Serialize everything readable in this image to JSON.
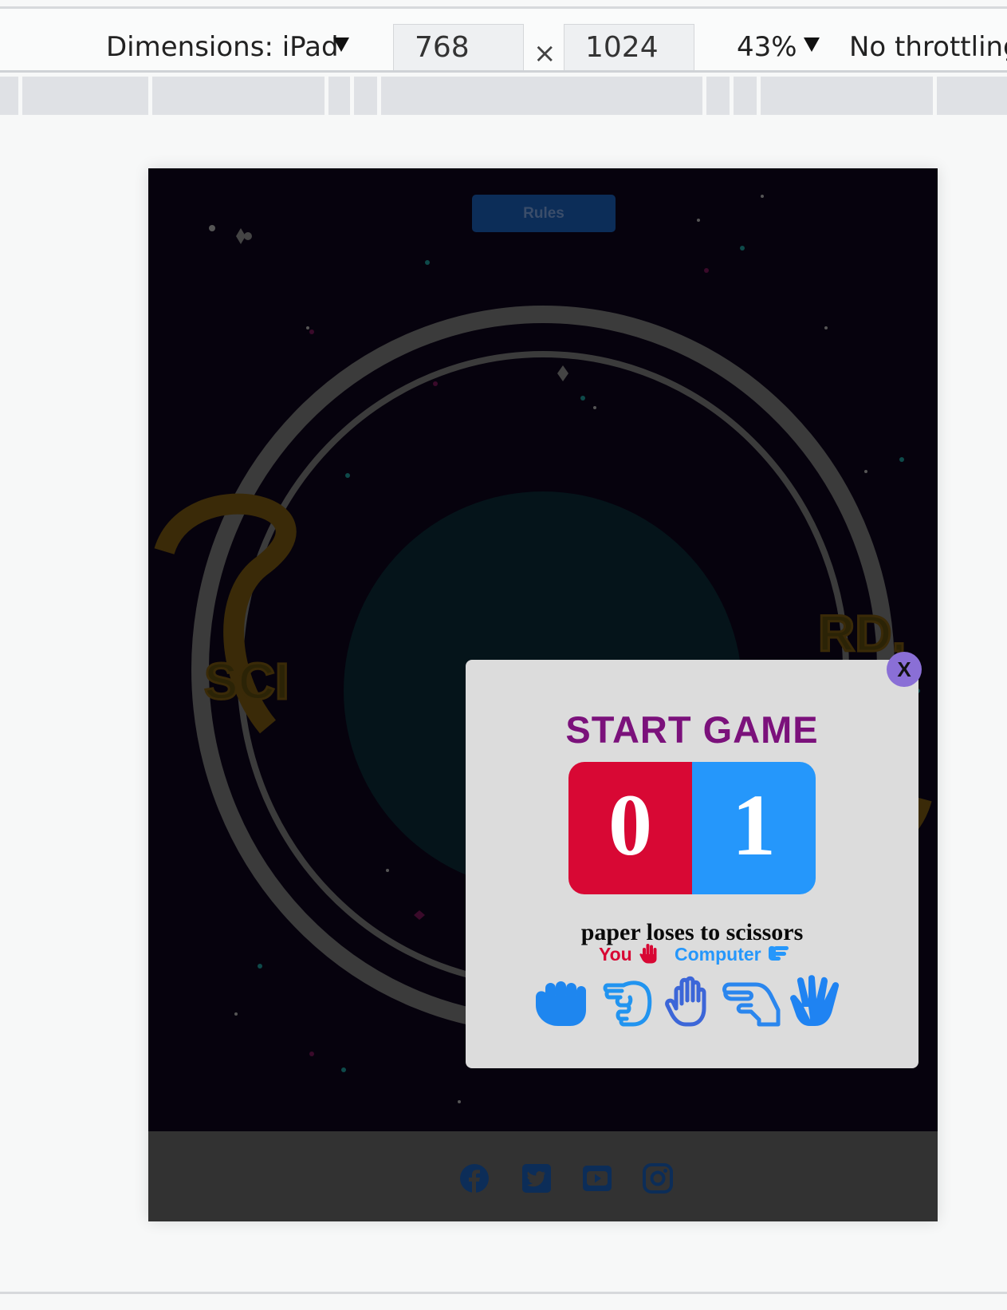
{
  "devtools": {
    "dimensions_label": "Dimensions: iPad",
    "width": "768",
    "times": "×",
    "height": "1024",
    "zoom": "43%",
    "throttling": "No throttling"
  },
  "page": {
    "rules_label": "Rules",
    "footer_icons": [
      "facebook-icon",
      "twitter-icon",
      "youtube-icon",
      "instagram-icon"
    ]
  },
  "modal": {
    "close_label": "X",
    "title": "START GAME",
    "score": {
      "you": "0",
      "computer": "1"
    },
    "result": "paper loses to scissors",
    "you_label": "You",
    "computer_label": "Computer",
    "you_choice_icon": "hand-paper-icon",
    "computer_choice_icon": "hand-scissors-icon",
    "choices": [
      {
        "icon": "hand-rock-icon",
        "color": "#1e86ef"
      },
      {
        "icon": "hand-scissors-icon",
        "color": "#2194f0"
      },
      {
        "icon": "hand-paper-icon",
        "color": "#3c66d8"
      },
      {
        "icon": "hand-lizard-icon",
        "color": "#2a86ee"
      },
      {
        "icon": "hand-spock-icon",
        "color": "#1f83f2"
      }
    ]
  },
  "colors": {
    "you": "#d80834",
    "computer": "#2597fb",
    "title": "#7b117b",
    "close": "#8a6fd6",
    "modal_bg": "#dcdcdc"
  }
}
